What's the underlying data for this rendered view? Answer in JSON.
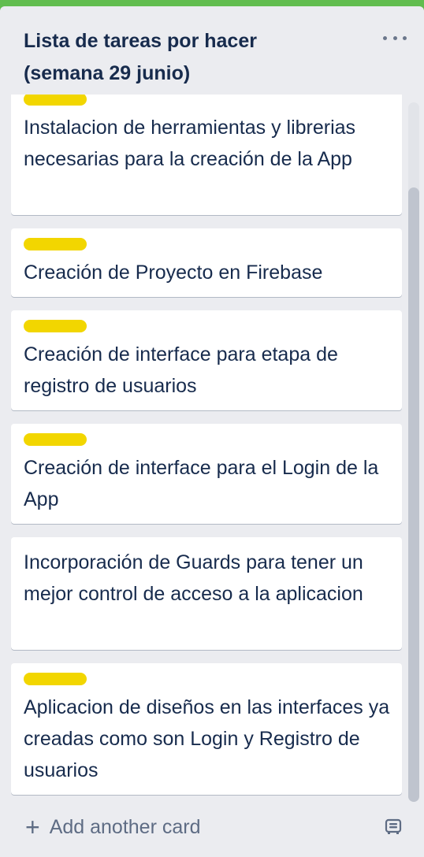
{
  "list": {
    "title_line1": "Lista de tareas por hacer",
    "title_line2": "(semana 29 junio)",
    "menu_icon": "more-horizontal-icon"
  },
  "cards": [
    {
      "title": "Instalacion de herramientas y librerias necesarias para la creación de la App",
      "label_color": "#f2d600"
    },
    {
      "title": "Creación de Proyecto en Firebase",
      "label_color": "#f2d600"
    },
    {
      "title": "Creación de interface para etapa de registro de usuarios",
      "label_color": "#f2d600"
    },
    {
      "title": "Creación de interface para el Login de la App",
      "label_color": "#f2d600"
    },
    {
      "title": "Incorporación de Guards para tener un mejor control de acceso a la aplicacion",
      "label_color": null
    },
    {
      "title": "Aplicacion de diseños en las interfaces ya creadas como son Login y Registro de usuarios",
      "label_color": "#f2d600"
    }
  ],
  "footer": {
    "add_card_label": "Add another card",
    "add_icon": "plus-icon",
    "template_icon": "card-template-icon"
  }
}
